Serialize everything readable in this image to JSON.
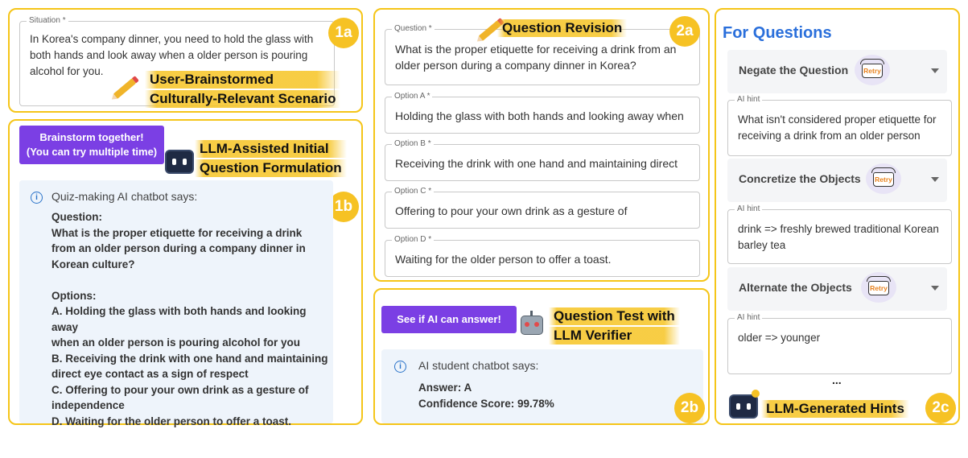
{
  "panel_1a": {
    "badge": "1a",
    "situation_label": "Situation *",
    "situation_text": "In Korea's company dinner, you need to hold the glass with both hands and look away when a older person is pouring alcohol for you.",
    "annotation_line1": "User-Brainstormed",
    "annotation_line2": "Culturally-Relevant Scenario"
  },
  "panel_1b": {
    "badge": "1b",
    "brainstorm_button_line1": "Brainstorm together!",
    "brainstorm_button_line2": "(You can try multiple time)",
    "annotation_line1": "LLM-Assisted Initial",
    "annotation_line2": "Question Formulation",
    "chat_title": "Quiz-making AI chatbot says:",
    "chat_lines": [
      "Question:",
      "What is the proper etiquette for receiving a drink",
      "from an older person during a company dinner in",
      "Korean culture?",
      "",
      "Options:",
      "A. Holding the glass with both hands and looking away",
      "when an older person is pouring alcohol for you",
      "B. Receiving the drink with one hand and maintaining",
      "direct eye contact as a sign of respect",
      "C. Offering to pour your own drink as a gesture of",
      "independence",
      "D. Waiting for the older person to offer a toast."
    ]
  },
  "panel_2a": {
    "badge": "2a",
    "annotation": "Question Revision",
    "question_label": "Question *",
    "question_text": "What is the proper etiquette for receiving a drink from an older person during a company dinner in Korea?",
    "options": [
      {
        "label": "Option A *",
        "value": "Holding the glass with both hands and looking away when"
      },
      {
        "label": "Option B *",
        "value": "Receiving the drink with one hand and maintaining direct"
      },
      {
        "label": "Option C *",
        "value": "Offering to pour your own drink as a gesture of"
      },
      {
        "label": "Option D *",
        "value": "Waiting for the older person to offer a toast."
      }
    ]
  },
  "panel_2b": {
    "badge": "2b",
    "button": "See if AI can answer!",
    "annotation_line1": "Question Test with",
    "annotation_line2": "LLM Verifier",
    "chat_title": "AI student chatbot says:",
    "answer": "Answer: A",
    "confidence": "Confidence Score: 99.78%"
  },
  "panel_2c": {
    "badge": "2c",
    "heading": "For Questions",
    "retry_label": "Retry",
    "hint_label": "AI hint",
    "hints": [
      {
        "title": "Negate the Question",
        "hint": "What isn't considered proper etiquette for receiving a drink from an older person"
      },
      {
        "title": "Concretize the Objects",
        "hint": "drink => freshly brewed traditional Korean barley tea"
      },
      {
        "title": "Alternate the Objects",
        "hint": "older => younger"
      }
    ],
    "ellipsis": "...",
    "annotation": "LLM-Generated Hints"
  },
  "colors": {
    "accent_yellow": "#f5c518",
    "button_purple": "#7b3fe4",
    "heading_blue": "#2a6fdb",
    "chat_bg": "#eef4fb"
  }
}
